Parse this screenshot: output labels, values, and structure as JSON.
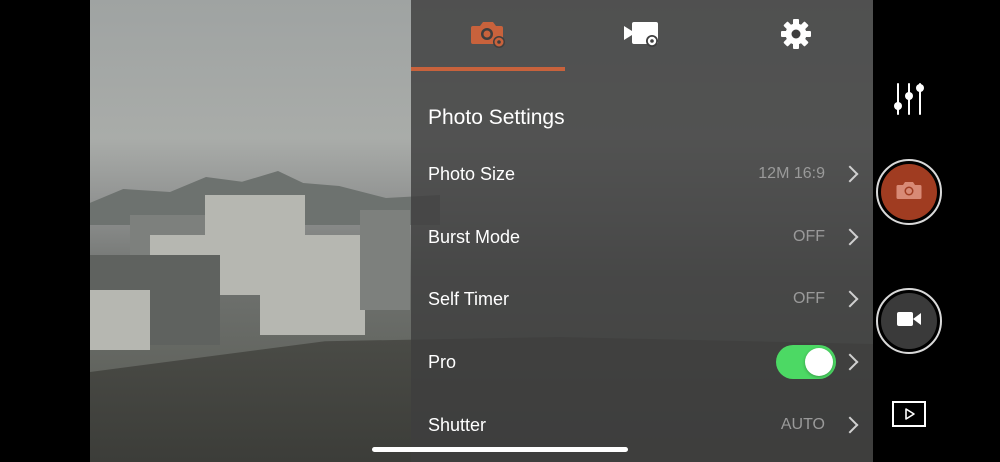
{
  "tabs": [
    {
      "name": "photo",
      "icon": "camera-settings-icon",
      "active": true
    },
    {
      "name": "video",
      "icon": "video-settings-icon",
      "active": false
    },
    {
      "name": "general",
      "icon": "gear-icon",
      "active": false
    }
  ],
  "panel": {
    "title": "Photo Settings",
    "rows": [
      {
        "label": "Photo Size",
        "value": "12M 16:9"
      },
      {
        "label": "Burst Mode",
        "value": "OFF"
      },
      {
        "label": "Self Timer",
        "value": "OFF"
      },
      {
        "label": "Pro",
        "value": "",
        "toggle_on": true
      },
      {
        "label": "Shutter",
        "value": "AUTO"
      }
    ]
  },
  "controls": {
    "adjust_icon": "sliders-icon",
    "photo_shutter_icon": "camera-icon",
    "video_record_icon": "video-camera-icon",
    "playback_icon": "playback-icon"
  },
  "colors": {
    "accent": "#c8623c",
    "toggle_on": "#4cd964",
    "photo_shutter": "#a03c21",
    "video_shutter": "#3a3a3a"
  }
}
